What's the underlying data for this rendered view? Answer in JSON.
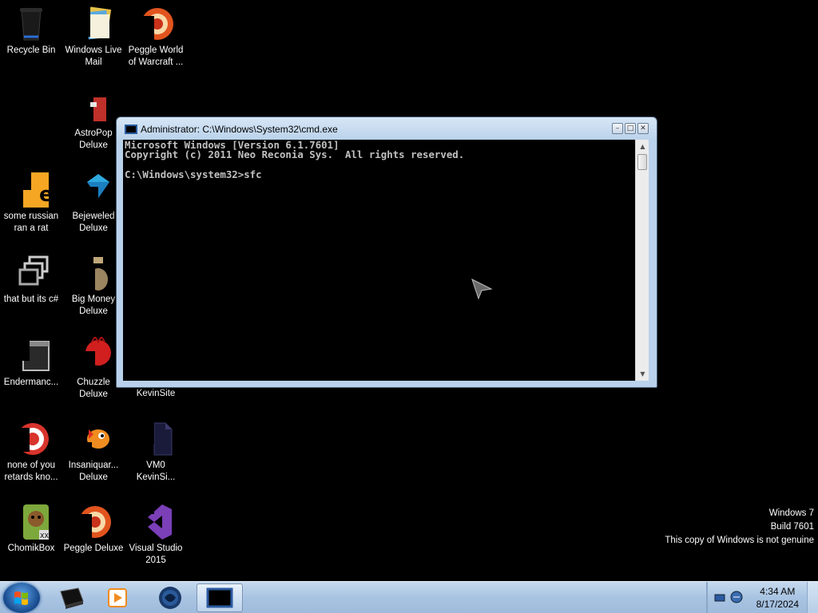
{
  "desktop": {
    "icons": [
      {
        "label": "Recycle Bin",
        "icon": "recycle-bin-icon"
      },
      {
        "label": "Windows Live\nMail",
        "icon": "mail-icon"
      },
      {
        "label": "Peggle World\nof Warcraft ...",
        "icon": "peggle-icon"
      },
      {
        "label": "AstroPop\nDeluxe",
        "icon": "astropop-icon"
      },
      {
        "label": "some russian\nran a rat",
        "icon": "app-icon"
      },
      {
        "label": "Bejeweled\nDeluxe",
        "icon": "bejeweled-icon"
      },
      {
        "label": "that but its c#",
        "icon": "windows-stack-icon"
      },
      {
        "label": "Big Money\nDeluxe",
        "icon": "big-money-icon"
      },
      {
        "label": "Endermanc...",
        "icon": "window-icon"
      },
      {
        "label": "Chuzzle\nDeluxe",
        "icon": "chuzzle-icon"
      },
      {
        "label": "KevinSite",
        "icon": "file-icon"
      },
      {
        "label": "none of you\nretards kno...",
        "icon": "chrome-icon"
      },
      {
        "label": "Insaniquar...\nDeluxe",
        "icon": "fish-icon"
      },
      {
        "label": "VM0\nKevinSi...",
        "icon": "file-icon"
      },
      {
        "label": "ChomikBox",
        "icon": "hamster-icon"
      },
      {
        "label": "Peggle Deluxe",
        "icon": "peggle-icon"
      },
      {
        "label": "Visual Studio\n2015",
        "icon": "visual-studio-icon"
      }
    ]
  },
  "cmd": {
    "title": "Administrator: C:\\Windows\\System32\\cmd.exe",
    "output": "Microsoft Windows [Version 6.1.7601]\nCopyright (c) 2011 Neo Reconia Sys.  All rights reserved.\n\nC:\\Windows\\system32>sfc",
    "minimize": "–",
    "maximize": "□",
    "close": "✕",
    "scroll_up": "▲",
    "scroll_down": "▼"
  },
  "watermark": {
    "line1": "Windows 7",
    "line2": "Build 7601",
    "line3": "This copy of Windows is not genuine"
  },
  "taskbar": {
    "pinned": [
      "cmd-icon",
      "media-player-icon",
      "browser-icon",
      "console-icon"
    ],
    "clock_time": "4:34 AM",
    "clock_date": "8/17/2024"
  },
  "colors": {
    "taskbar": "#a9c4e2",
    "console_bg": "#000000",
    "console_text": "#c0c0c0"
  }
}
